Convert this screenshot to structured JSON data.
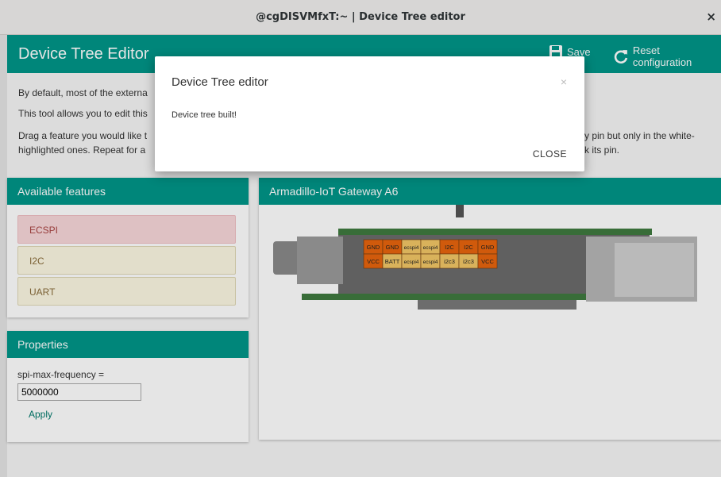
{
  "window": {
    "title": "@cgDISVMfxT:~ | Device Tree editor",
    "close_glyph": "×"
  },
  "header": {
    "title": "Device Tree Editor",
    "save_label": "Save",
    "reset_label": "Reset configuration"
  },
  "intro": {
    "line1_visible": "By default, most of the externa",
    "line2_visible": "This tool allows you to edit this",
    "line3_left": "Drag a feature you would like t",
    "line3_right": "y pin but only in the white-",
    "line4_left": "highlighted ones. Repeat for a",
    "line4_right": "k its pin."
  },
  "features_panel": {
    "title": "Available features",
    "items": [
      {
        "label": "ECSPI",
        "state": "active"
      },
      {
        "label": "I2C",
        "state": "normal"
      },
      {
        "label": "UART",
        "state": "normal"
      }
    ]
  },
  "properties_panel": {
    "title": "Properties",
    "field_label": "spi-max-frequency =",
    "field_value": "5000000",
    "apply_label": "Apply"
  },
  "board_panel": {
    "title": "Armadillo-IoT Gateway A6",
    "pins_top": [
      "GND",
      "GND",
      "ecspi4",
      "ecspi4",
      "I2C",
      "I2C",
      "GND"
    ],
    "pins_bottom": [
      "VCC",
      "BATT",
      "ecspi4",
      "ecspi4",
      "i2c3",
      "i2c3",
      "VCC"
    ]
  },
  "modal": {
    "title": "Device Tree editor",
    "close_glyph": "×",
    "message": "Device tree built!",
    "close_button": "CLOSE"
  },
  "colors": {
    "accent": "#009688",
    "pin_orange": "#e8650e",
    "pin_highlight": "#f2c766",
    "feature_active_bg": "#f8d7da",
    "feature_bg": "#fcf8e3"
  }
}
